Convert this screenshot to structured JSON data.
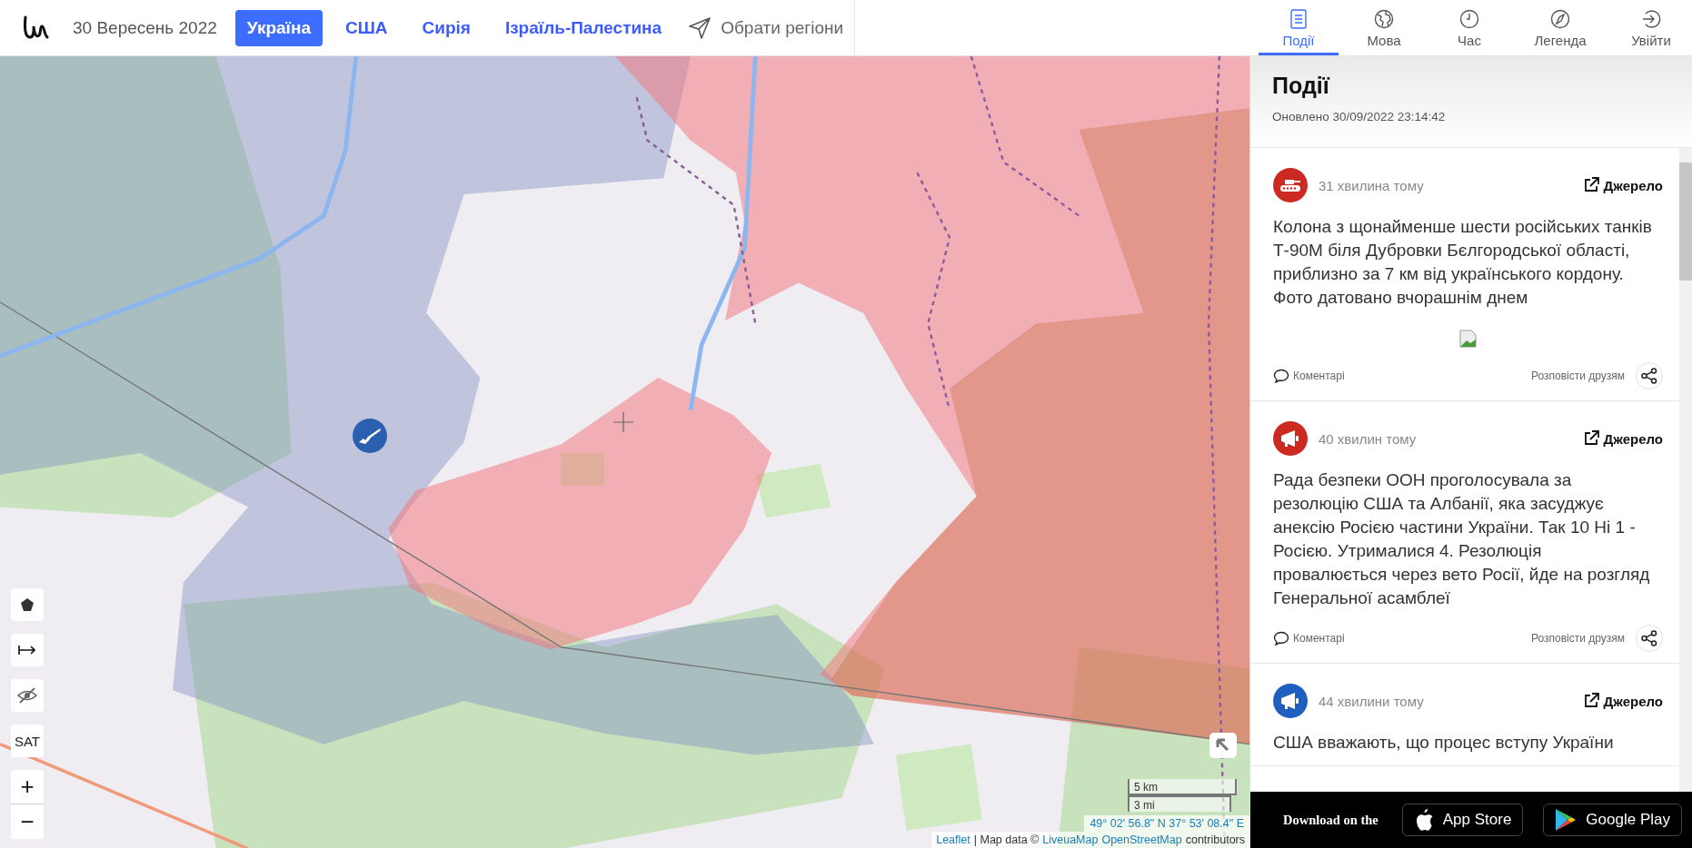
{
  "header": {
    "date": "30 Вересень 2022",
    "regions": [
      {
        "label": "Україна",
        "selected": true
      },
      {
        "label": "США",
        "selected": false
      },
      {
        "label": "Сирія",
        "selected": false
      },
      {
        "label": "Ізраїль-Палестина",
        "selected": false
      }
    ],
    "choose_regions": "Обрати регіони"
  },
  "panel_tabs": [
    {
      "kind": "events",
      "label": "Події",
      "selected": true
    },
    {
      "kind": "language",
      "label": "Мова",
      "selected": false
    },
    {
      "kind": "time",
      "label": "Час",
      "selected": false
    },
    {
      "kind": "legend",
      "label": "Легенда",
      "selected": false
    },
    {
      "kind": "login",
      "label": "Увійти",
      "selected": false
    }
  ],
  "map": {
    "controls": [
      {
        "kind": "polygon"
      },
      {
        "kind": "measure"
      },
      {
        "kind": "hide"
      },
      {
        "kind": "text",
        "label": "SAT"
      }
    ],
    "zoom": [
      "+",
      "−"
    ],
    "scale": [
      "5 km",
      "3 mi"
    ],
    "coordinates": "49° 02' 56.8\" N 37° 53' 08.4\" E",
    "attribution": [
      {
        "text": "Leaflet",
        "link": true
      },
      {
        "text": "| Map data ©",
        "link": false
      },
      {
        "text": "LiveuaMap",
        "link": true
      },
      {
        "text": "OpenStreetMap",
        "link": true
      },
      {
        "text": "contributors",
        "link": false
      }
    ]
  },
  "events_panel": {
    "title": "Події",
    "updated": "Оновлено 30/09/2022 23:14:42",
    "events": [
      {
        "kind": "tank",
        "color": "#cc2a20",
        "time": "31 хвилина тому",
        "source": "Джерело",
        "text": "Колона з щонайменше шести російських танків Т-90М біля Дубровки Бєлгородської області, приблизно за 7 км від українського кордону. Фото датовано вчорашнім днем",
        "photo": true,
        "comments": "Коментарі",
        "share": "Розповісти друзям"
      },
      {
        "kind": "megaphone",
        "color": "#cc2a20",
        "time": "40 хвилин тому",
        "source": "Джерело",
        "text": "Рада безпеки ООН проголосувала за резолюцію США та Албанії, яка засуджує анексію Росією частини України. Так 10 Ні 1 - Росією. Утрималися 4. Резолюція провалюється через вето Росії, йде на розгляд Генеральної асамблеї",
        "photo": false,
        "comments": "Коментарі",
        "share": "Розповісти друзям"
      },
      {
        "kind": "megaphone",
        "color": "#1f5fc0",
        "time": "44 хвилини тому",
        "source": "Джерело",
        "text": "США вважають, що процес вступу України",
        "photo": false
      }
    ]
  },
  "app_bar": {
    "download": "Download on the",
    "stores": [
      {
        "kind": "apple",
        "label": "App Store"
      },
      {
        "kind": "google",
        "label": "Google Play"
      }
    ]
  }
}
